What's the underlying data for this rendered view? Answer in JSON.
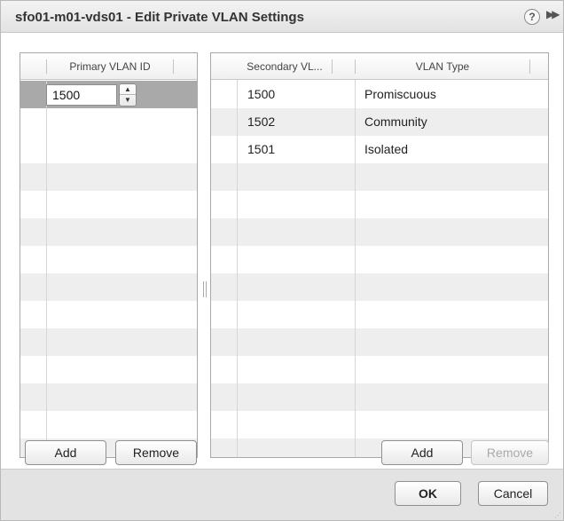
{
  "dialog": {
    "title": "sfo01-m01-vds01 - Edit Private VLAN Settings",
    "help_icon_glyph": "?",
    "expand_icon_glyph": "▶▶"
  },
  "primary_grid": {
    "header": "Primary VLAN ID",
    "selected_value": "1500",
    "add_label": "Add",
    "remove_label": "Remove"
  },
  "secondary_grid": {
    "headers": [
      "Secondary VL...",
      "VLAN Type"
    ],
    "rows": [
      {
        "id": "1500",
        "type": "Promiscuous"
      },
      {
        "id": "1502",
        "type": "Community"
      },
      {
        "id": "1501",
        "type": "Isolated"
      }
    ],
    "add_label": "Add",
    "remove_label": "Remove"
  },
  "footer": {
    "ok_label": "OK",
    "cancel_label": "Cancel"
  },
  "colors": {
    "selected_row": "#a9a9a9",
    "alt_row": "#eeeeee",
    "footer_bg": "#e3e3e3"
  }
}
